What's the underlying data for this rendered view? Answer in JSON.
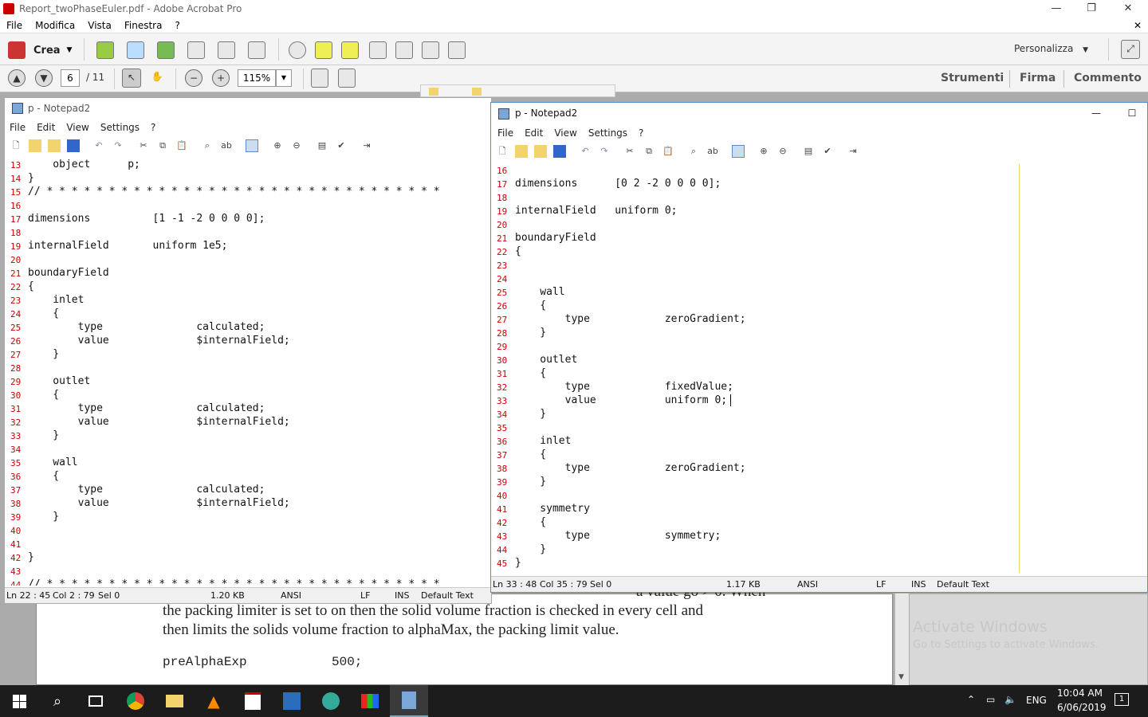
{
  "acrobat": {
    "title": "Report_twoPhaseEuler.pdf - Adobe Acrobat Pro",
    "menu": [
      "File",
      "Modifica",
      "Vista",
      "Finestra",
      "?"
    ],
    "crea_label": "Crea",
    "personalizza_label": "Personalizza",
    "page_current": "6",
    "page_total": "/ 11",
    "zoom": "115%",
    "right_links": [
      "Strumenti",
      "Firma",
      "Commento"
    ],
    "window_controls": {
      "minimize": "—",
      "restore": "❐",
      "close": "✕",
      "doc_close": "✕"
    }
  },
  "pdf": {
    "line0": "a value go > 0. When",
    "line1": "the packing limiter is set to on then the solid volume fraction is checked in every cell and",
    "line2": "then limits the solids volume fraction to alphaMax, the packing limit value.",
    "code_key": "preAlphaExp",
    "code_val": "500;"
  },
  "activation": {
    "title": "Activate Windows",
    "subtitle": "Go to Settings to activate Windows."
  },
  "left_notepad": {
    "title": "p - Notepad2",
    "menu": [
      "File",
      "Edit",
      "View",
      "Settings",
      "?"
    ],
    "lines": [
      {
        "n": "13",
        "t": "    object      p;"
      },
      {
        "n": "14",
        "t": "}"
      },
      {
        "n": "15",
        "t": "// * * * * * * * * * * * * * * * * * * * * * * * * * * * * * * * *"
      },
      {
        "n": "16",
        "t": ""
      },
      {
        "n": "17",
        "t": "dimensions          [1 -1 -2 0 0 0 0];"
      },
      {
        "n": "18",
        "t": ""
      },
      {
        "n": "19",
        "t": "internalField       uniform 1e5;"
      },
      {
        "n": "20",
        "t": ""
      },
      {
        "n": "21",
        "t": "boundaryField"
      },
      {
        "n": "22",
        "t": "{"
      },
      {
        "n": "23",
        "t": "    inlet"
      },
      {
        "n": "24",
        "t": "    {"
      },
      {
        "n": "25",
        "t": "        type               calculated;"
      },
      {
        "n": "26",
        "t": "        value              $internalField;"
      },
      {
        "n": "27",
        "t": "    }"
      },
      {
        "n": "28",
        "t": ""
      },
      {
        "n": "29",
        "t": "    outlet"
      },
      {
        "n": "30",
        "t": "    {"
      },
      {
        "n": "31",
        "t": "        type               calculated;"
      },
      {
        "n": "32",
        "t": "        value              $internalField;"
      },
      {
        "n": "33",
        "t": "    }"
      },
      {
        "n": "34",
        "t": ""
      },
      {
        "n": "35",
        "t": "    wall"
      },
      {
        "n": "36",
        "t": "    {"
      },
      {
        "n": "37",
        "t": "        type               calculated;"
      },
      {
        "n": "38",
        "t": "        value              $internalField;"
      },
      {
        "n": "39",
        "t": "    }"
      },
      {
        "n": "40",
        "t": ""
      },
      {
        "n": "41",
        "t": ""
      },
      {
        "n": "42",
        "t": "}"
      },
      {
        "n": "43",
        "t": ""
      },
      {
        "n": "44",
        "t": "// * * * * * * * * * * * * * * * * * * * * * * * * * * * * * * * *"
      }
    ],
    "status": {
      "pos": "Ln 22 : 45",
      "col": "Col 2 : 79",
      "sel": "Sel 0",
      "size": "1.20 KB",
      "enc": "ANSI",
      "eol": "LF",
      "mode": "INS",
      "scheme": "Default Text"
    }
  },
  "right_notepad": {
    "title": "p - Notepad2",
    "menu": [
      "File",
      "Edit",
      "View",
      "Settings",
      "?"
    ],
    "window_controls": {
      "minimize": "—",
      "maximize": "☐"
    },
    "lines": [
      {
        "n": "16",
        "t": ""
      },
      {
        "n": "17",
        "t": "dimensions      [0 2 -2 0 0 0 0];"
      },
      {
        "n": "18",
        "t": ""
      },
      {
        "n": "19",
        "t": "internalField   uniform 0;"
      },
      {
        "n": "20",
        "t": ""
      },
      {
        "n": "21",
        "t": "boundaryField"
      },
      {
        "n": "22",
        "t": "{"
      },
      {
        "n": "23",
        "t": ""
      },
      {
        "n": "24",
        "t": ""
      },
      {
        "n": "25",
        "t": "    wall"
      },
      {
        "n": "26",
        "t": "    {"
      },
      {
        "n": "27",
        "t": "        type            zeroGradient;"
      },
      {
        "n": "28",
        "t": "    }"
      },
      {
        "n": "29",
        "t": ""
      },
      {
        "n": "30",
        "t": "    outlet"
      },
      {
        "n": "31",
        "t": "    {"
      },
      {
        "n": "32",
        "t": "        type            fixedValue;"
      },
      {
        "n": "33",
        "t": "        value           uniform 0;"
      },
      {
        "n": "34",
        "t": "    }"
      },
      {
        "n": "35",
        "t": ""
      },
      {
        "n": "36",
        "t": "    inlet"
      },
      {
        "n": "37",
        "t": "    {"
      },
      {
        "n": "38",
        "t": "        type            zeroGradient;"
      },
      {
        "n": "39",
        "t": "    }"
      },
      {
        "n": "40",
        "t": ""
      },
      {
        "n": "41",
        "t": "    symmetry"
      },
      {
        "n": "42",
        "t": "    {"
      },
      {
        "n": "43",
        "t": "        type            symmetry;"
      },
      {
        "n": "44",
        "t": "    }"
      },
      {
        "n": "45",
        "t": "}"
      }
    ],
    "status": {
      "pos": "Ln 33 : 48",
      "col": "Col 35 : 79",
      "sel": "Sel 0",
      "size": "1.17 KB",
      "enc": "ANSI",
      "eol": "LF",
      "mode": "INS",
      "scheme": "Default Text"
    }
  },
  "taskbar": {
    "lang": "ENG",
    "time": "10:04 AM",
    "date": "6/06/2019",
    "notif_count": "1"
  }
}
